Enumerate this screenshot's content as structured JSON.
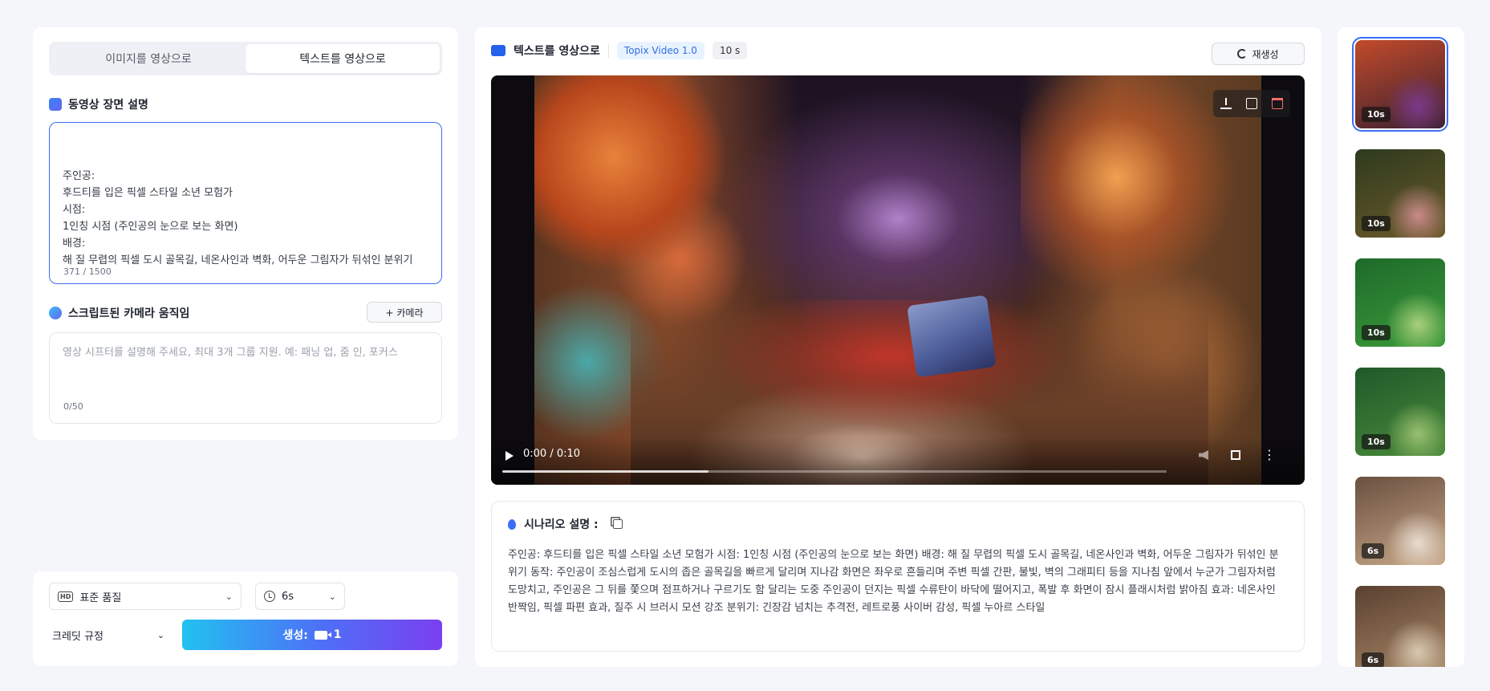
{
  "left_panel": {
    "tabs": [
      {
        "label": "이미지를 영상으로",
        "active": false
      },
      {
        "label": "텍스트를 영상으로",
        "active": true
      }
    ],
    "scene_section_title": "동영상 장면 설명",
    "scene_text": "주인공:\n후드티를 입은 픽셀 스타일 소년 모험가\n시점:\n1인칭 시점 (주인공의 눈으로 보는 화면)\n배경:\n해 질 무렵의 픽셀 도시 골목길, 네온사인과 벽화, 어두운 그림자가 뒤섞인 분위기",
    "scene_counter": "371 / 1500",
    "camera_section_title": "스크립트된 카메라 움직임",
    "camera_button_label": "+ 카메라",
    "camera_placeholder": "영상 시프터를 설명해 주세요, 최대 3개 그룹 지원. 예: 패닝 업, 줌 인, 포커스",
    "camera_counter": "0/50"
  },
  "bottom_controls": {
    "quality_label": "표준 품질",
    "duration_label": "6s",
    "credit_label": "크레딧 규정",
    "generate_label": "생성:",
    "generate_count": "1"
  },
  "center": {
    "title": "텍스트를 영상으로",
    "model_badge": "Topix Video 1.0",
    "duration_badge": "10 s",
    "regenerate_label": "재생성",
    "video": {
      "time_display": "0:00 / 0:10",
      "progress_fraction": 0.31
    },
    "scenario_title": "시나리오 설명 :",
    "scenario_text": "주인공: 후드티를 입은 픽셀 스타일 소년 모험가 시점: 1인칭 시점 (주인공의 눈으로 보는 화면) 배경: 해 질 무렵의 픽셀 도시 골목길, 네온사인과 벽화, 어두운 그림자가 뒤섞인 분위기 동작: 주인공이 조심스럽게 도시의 좁은 골목길을 빠르게 달리며 지나감 화면은 좌우로 흔들리며 주변 픽셀 간판, 불빛, 벽의 그래피티 등을 지나침 앞에서 누군가 그림자처럼 도망치고, 주인공은 그 뒤를 쫓으며 점프하거나 구르기도 함 달리는 도중 주인공이 던지는 픽셀 수류탄이 바닥에 떨어지고, 폭발 후 화면이 잠시 플래시처럼 밝아짐 효과: 네온사인 반짝임, 픽셀 파편 효과, 질주 시 브러시 모션 강조 분위기: 긴장감 넘치는 추격전, 레트로풍 사이버 감성, 픽셀 누아르 스타일"
  },
  "thumbnails": [
    {
      "duration": "10s",
      "selected": true,
      "colors": [
        "#c24a2a",
        "#3a2030",
        "#7a3a8a"
      ]
    },
    {
      "duration": "10s",
      "selected": false,
      "colors": [
        "#2e3a1e",
        "#6a5a2a",
        "#c98a8a"
      ]
    },
    {
      "duration": "10s",
      "selected": false,
      "colors": [
        "#1e6a2a",
        "#3a9a3a",
        "#a8d07a"
      ]
    },
    {
      "duration": "10s",
      "selected": false,
      "colors": [
        "#1e5a2a",
        "#4a8a3a",
        "#9ac070"
      ]
    },
    {
      "duration": "6s",
      "selected": false,
      "colors": [
        "#6a5040",
        "#c8a888",
        "#e8dcd0"
      ]
    },
    {
      "duration": "6s",
      "selected": false,
      "colors": [
        "#5a4030",
        "#a88868",
        "#d8c8b0"
      ]
    }
  ]
}
